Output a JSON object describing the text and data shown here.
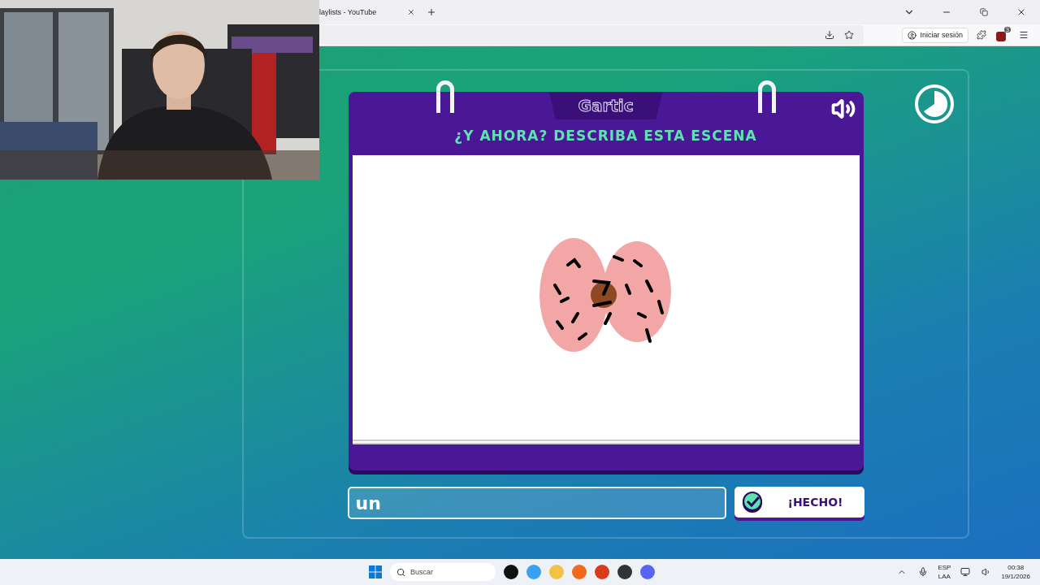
{
  "browser": {
    "tab_title": "laylists - YouTube",
    "sign_in": "Iniciar sesión",
    "extension_badge": "3"
  },
  "game": {
    "logo": "Gartic",
    "heading": "¿Y AHORA? DESCRIBA ESTA ESCENA",
    "answer": "un",
    "done_button": "¡HECHO!"
  },
  "taskbar": {
    "search_placeholder": "Buscar",
    "language": "ESP",
    "layout": "LAA",
    "time": "00:38",
    "date": "19/1/2026"
  }
}
